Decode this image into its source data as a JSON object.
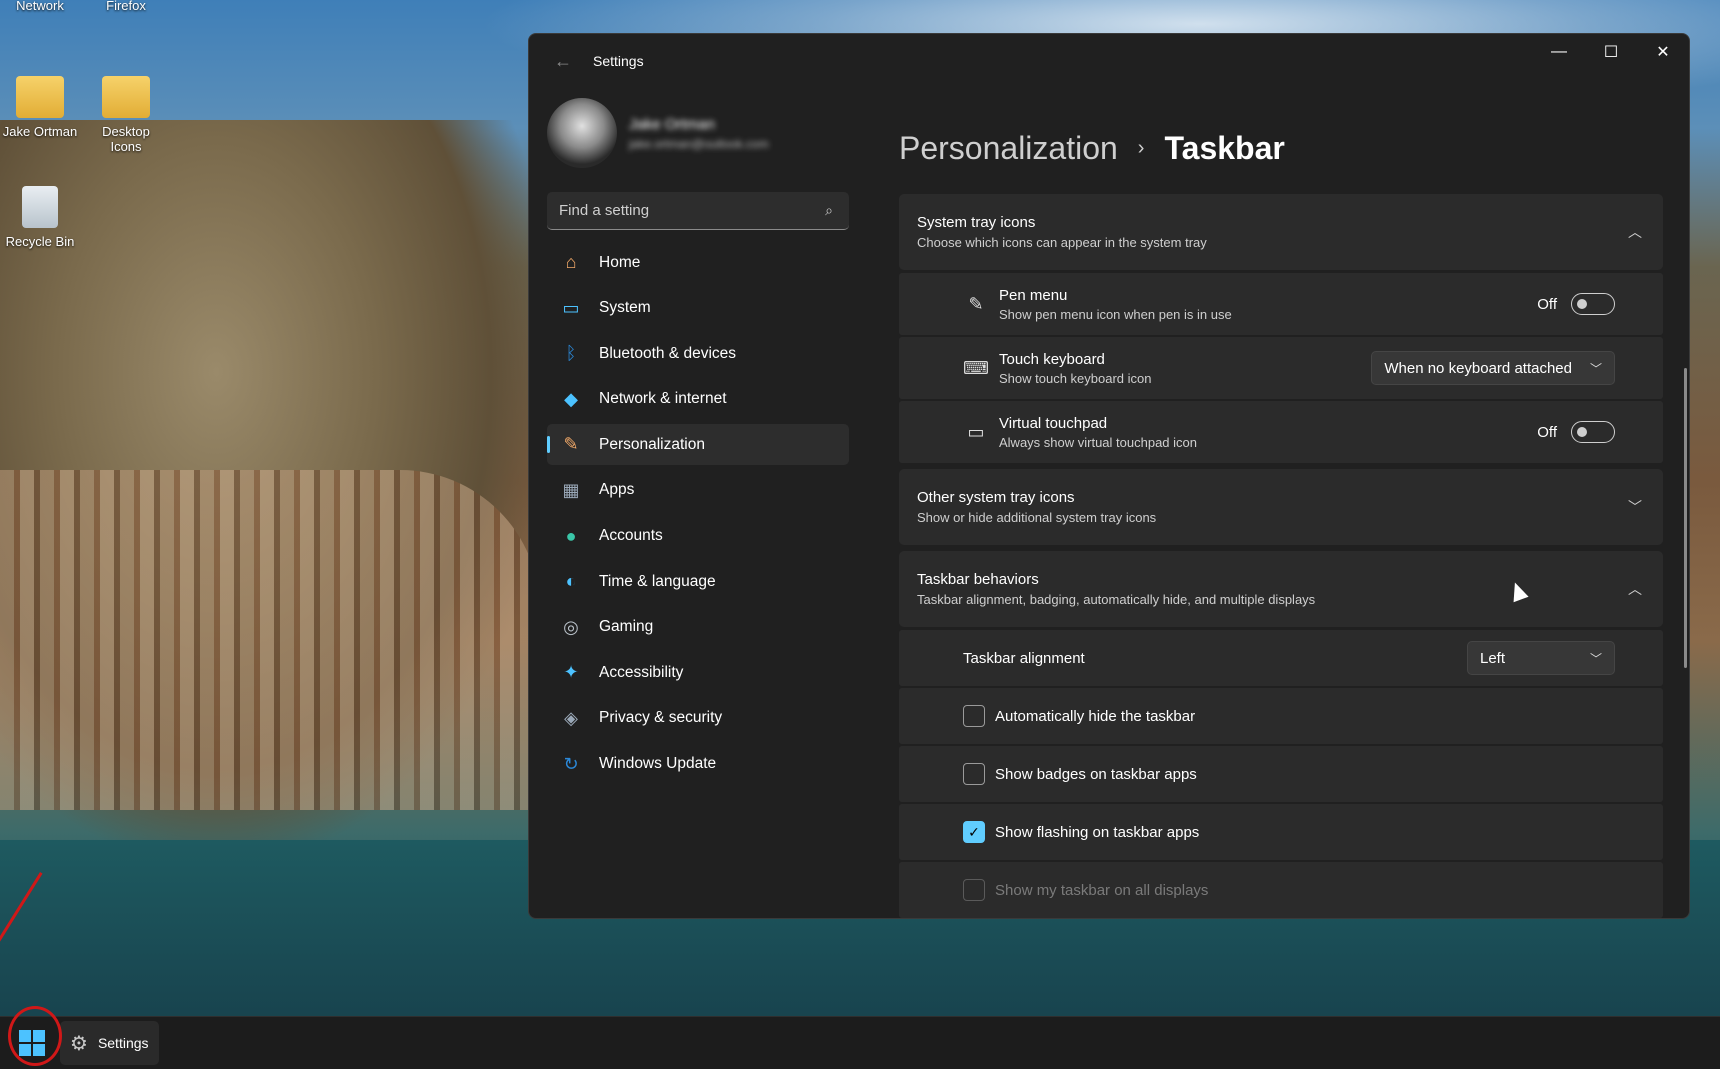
{
  "desktop": {
    "icons": [
      {
        "label": "Network"
      },
      {
        "label": "Firefox"
      },
      {
        "label": "Jake Ortman"
      },
      {
        "label": "Desktop Icons"
      },
      {
        "label": "Recycle Bin"
      }
    ]
  },
  "window": {
    "title": "Settings",
    "controls": {
      "minimize": "—",
      "maximize": "☐",
      "close": "✕"
    },
    "back": "←"
  },
  "profile": {
    "name": "Jake Ortman",
    "email": "jake.ortman@outlook.com"
  },
  "search": {
    "placeholder": "Find a setting",
    "icon": "⌕"
  },
  "nav": {
    "items": [
      {
        "label": "Home",
        "icon": "home-icon",
        "glyph": "⌂",
        "color": "#f0a868"
      },
      {
        "label": "System",
        "icon": "system-icon",
        "glyph": "▭",
        "color": "#4cc2ff"
      },
      {
        "label": "Bluetooth & devices",
        "icon": "bluetooth-icon",
        "glyph": "ᛒ",
        "color": "#2b88d8"
      },
      {
        "label": "Network & internet",
        "icon": "wifi-icon",
        "glyph": "◆",
        "color": "#4cc2ff"
      },
      {
        "label": "Personalization",
        "icon": "brush-icon",
        "glyph": "✎",
        "color": "#f0a868"
      },
      {
        "label": "Apps",
        "icon": "apps-icon",
        "glyph": "▦",
        "color": "#9aa8b8"
      },
      {
        "label": "Accounts",
        "icon": "accounts-icon",
        "glyph": "●",
        "color": "#3ac6a8"
      },
      {
        "label": "Time & language",
        "icon": "globe-clock-icon",
        "glyph": "◐",
        "color": "#4cc2ff"
      },
      {
        "label": "Gaming",
        "icon": "gamepad-icon",
        "glyph": "◎",
        "color": "#b8c0c8"
      },
      {
        "label": "Accessibility",
        "icon": "accessibility-icon",
        "glyph": "✦",
        "color": "#4cc2ff"
      },
      {
        "label": "Privacy & security",
        "icon": "shield-icon",
        "glyph": "◈",
        "color": "#9aa8b8"
      },
      {
        "label": "Windows Update",
        "icon": "update-icon",
        "glyph": "↻",
        "color": "#2b88d8"
      }
    ],
    "active_index": 4
  },
  "breadcrumb": {
    "parent": "Personalization",
    "separator": "›",
    "current": "Taskbar"
  },
  "system_tray": {
    "title": "System tray icons",
    "desc": "Choose which icons can appear in the system tray",
    "rows": {
      "pen": {
        "title": "Pen menu",
        "desc": "Show pen menu icon when pen is in use",
        "state": "Off"
      },
      "touch": {
        "title": "Touch keyboard",
        "desc": "Show touch keyboard icon",
        "value": "When no keyboard attached"
      },
      "touchpad": {
        "title": "Virtual touchpad",
        "desc": "Always show virtual touchpad icon",
        "state": "Off"
      }
    }
  },
  "other_tray": {
    "title": "Other system tray icons",
    "desc": "Show or hide additional system tray icons"
  },
  "behaviors": {
    "title": "Taskbar behaviors",
    "desc": "Taskbar alignment, badging, automatically hide, and multiple displays",
    "alignment_label": "Taskbar alignment",
    "alignment_value": "Left",
    "auto_hide": "Automatically hide the taskbar",
    "badges": "Show badges on taskbar apps",
    "flashing": "Show flashing on taskbar apps",
    "all_displays": "Show my taskbar on all displays"
  },
  "taskbar": {
    "app_label": "Settings"
  },
  "colors": {
    "accent": "#60cdff",
    "annotation": "#d01818"
  }
}
